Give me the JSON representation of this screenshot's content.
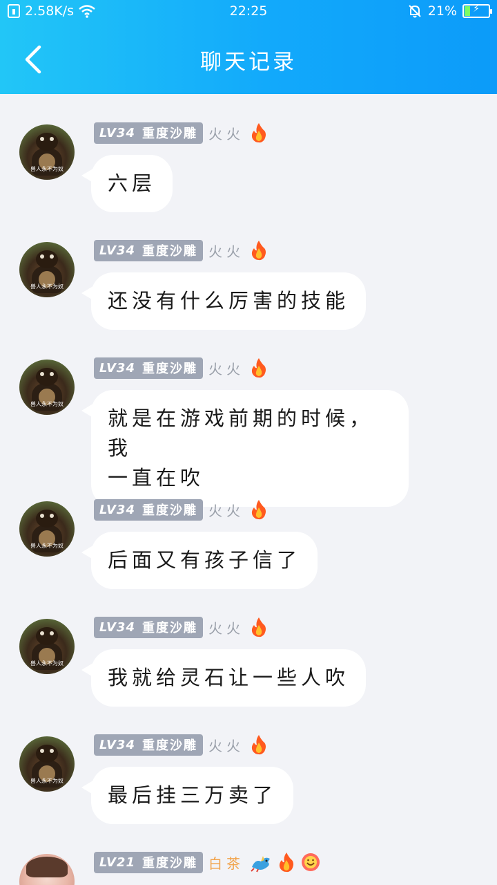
{
  "status_bar": {
    "net_speed": "2.58K/s",
    "time": "22:25",
    "battery_pct": "21%",
    "battery_level": 0.21
  },
  "header": {
    "title": "聊天记录"
  },
  "messages": [
    {
      "level": "LV34",
      "title": "重度沙雕",
      "nickname": "火火",
      "avatar_caption": "兽人永不为奴",
      "text": "六层"
    },
    {
      "level": "LV34",
      "title": "重度沙雕",
      "nickname": "火火",
      "avatar_caption": "兽人永不为奴",
      "text": "还没有什么厉害的技能"
    },
    {
      "level": "LV34",
      "title": "重度沙雕",
      "nickname": "火火",
      "avatar_caption": "兽人永不为奴",
      "text_line1": "就是在游戏前期的时候，我",
      "text_line2": "一直在吹"
    },
    {
      "level": "LV34",
      "title": "重度沙雕",
      "nickname": "火火",
      "avatar_caption": "兽人永不为奴",
      "text": "后面又有孩子信了"
    },
    {
      "level": "LV34",
      "title": "重度沙雕",
      "nickname": "火火",
      "avatar_caption": "兽人永不为奴",
      "text": "我就给灵石让一些人吹"
    },
    {
      "level": "LV34",
      "title": "重度沙雕",
      "nickname": "火火",
      "avatar_caption": "兽人永不为奴",
      "text": "最后挂三万卖了"
    },
    {
      "level": "LV21",
      "title": "重度沙雕",
      "nickname": "白茶"
    }
  ],
  "colors": {
    "header_gradient_start": "#22c6f7",
    "header_gradient_end": "#0c9bf9",
    "badge_bg": "#9fa6b5",
    "chat_bg": "#f2f3f7",
    "tea_name": "#f2a34b"
  },
  "icons": [
    "back-arrow-icon",
    "fire-icon",
    "dragon-icon",
    "smile-icon",
    "wifi-icon",
    "bell-off-icon",
    "battery-icon",
    "sim-icon"
  ]
}
